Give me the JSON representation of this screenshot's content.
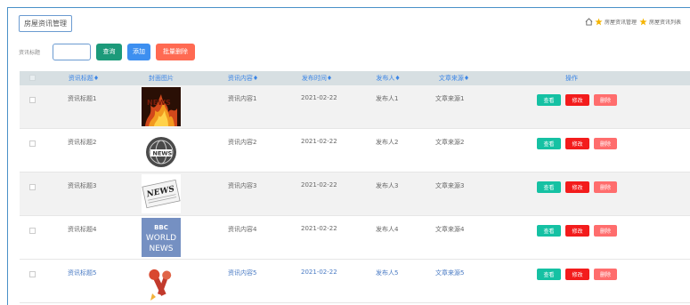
{
  "page": {
    "title": "房屋资讯管理"
  },
  "breadcrumb": {
    "items": [
      "房屋资讯管理",
      "房屋资讯列表"
    ],
    "colors": {
      "home": "#666666",
      "star": "#f5b400"
    }
  },
  "search": {
    "label": "资讯标题",
    "input_value": "",
    "query_label": "查询",
    "add_label": "添加",
    "batch_delete_label": "批量删除"
  },
  "table": {
    "headers": [
      "资讯标题",
      "封面图片",
      "资讯内容",
      "发布时间",
      "发布人",
      "文章来源",
      "操作"
    ],
    "sort_mark": "♦",
    "actions": {
      "view": "查看",
      "edit": "修改",
      "delete": "删除"
    },
    "rows": [
      {
        "title": "资讯标题1",
        "cover": "fire-news-image",
        "content": "资讯内容1",
        "date": "2021-02-22",
        "publisher": "发布人1",
        "source": "文章来源1"
      },
      {
        "title": "资讯标题2",
        "cover": "globe-news-image",
        "content": "资讯内容2",
        "date": "2021-02-22",
        "publisher": "发布人2",
        "source": "文章来源2"
      },
      {
        "title": "资讯标题3",
        "cover": "newspaper-image",
        "content": "资讯内容3",
        "date": "2021-02-22",
        "publisher": "发布人3",
        "source": "文章来源3"
      },
      {
        "title": "资讯标题4",
        "cover": "bbc-world-news-image",
        "content": "资讯内容4",
        "date": "2021-02-22",
        "publisher": "发布人4",
        "source": "文章来源4"
      },
      {
        "title": "资讯标题5",
        "cover": "microphones-image",
        "content": "资讯内容5",
        "date": "2021-02-22",
        "publisher": "发布人5",
        "source": "文章来源5"
      }
    ],
    "bbc_lines": [
      "BBC",
      "WORLD",
      "NEWS"
    ],
    "news_text": "NEWS"
  },
  "colors": {
    "frame": "#4a90c8",
    "header_bg": "#d7dfe2",
    "header_text": "#3b85e6",
    "query": "#1c9a7a",
    "add": "#3d8ff0",
    "batch_delete": "#ff6a52",
    "view": "#15c1a3",
    "edit": "#f31c1c",
    "delete": "#ff6d6d"
  }
}
